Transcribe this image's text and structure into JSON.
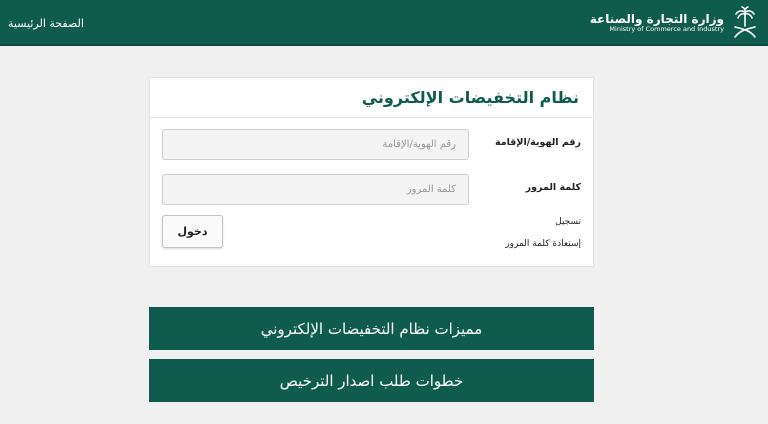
{
  "header": {
    "home_link": "الصفحة الرئيسية",
    "ministry_name_ar": "وزارة التجارة والصناعة",
    "ministry_name_en": "Ministry of Commerce and Industry",
    "emblem_icon": "palm-swords-emblem-icon",
    "background_color": "#0f5b4d"
  },
  "login": {
    "title": "نظام التخفيضات الإلكتروني",
    "id_label": "رقم الهوية/الإقامة",
    "id_placeholder": "رقم الهوية/الإقامة",
    "id_value": "",
    "password_label": "كلمة المرور",
    "password_placeholder": "كلمة المرور",
    "password_value": "",
    "submit_label": "دخول",
    "register_link": "تسجيل",
    "recover_link": "إستعادة كلمة المرور"
  },
  "sections": {
    "features_label": "مميزات نظام التخفيضات الإلكتروني",
    "steps_label": "خطوات طلب اصدار الترخيص",
    "accent_color": "#0f5b4d"
  }
}
